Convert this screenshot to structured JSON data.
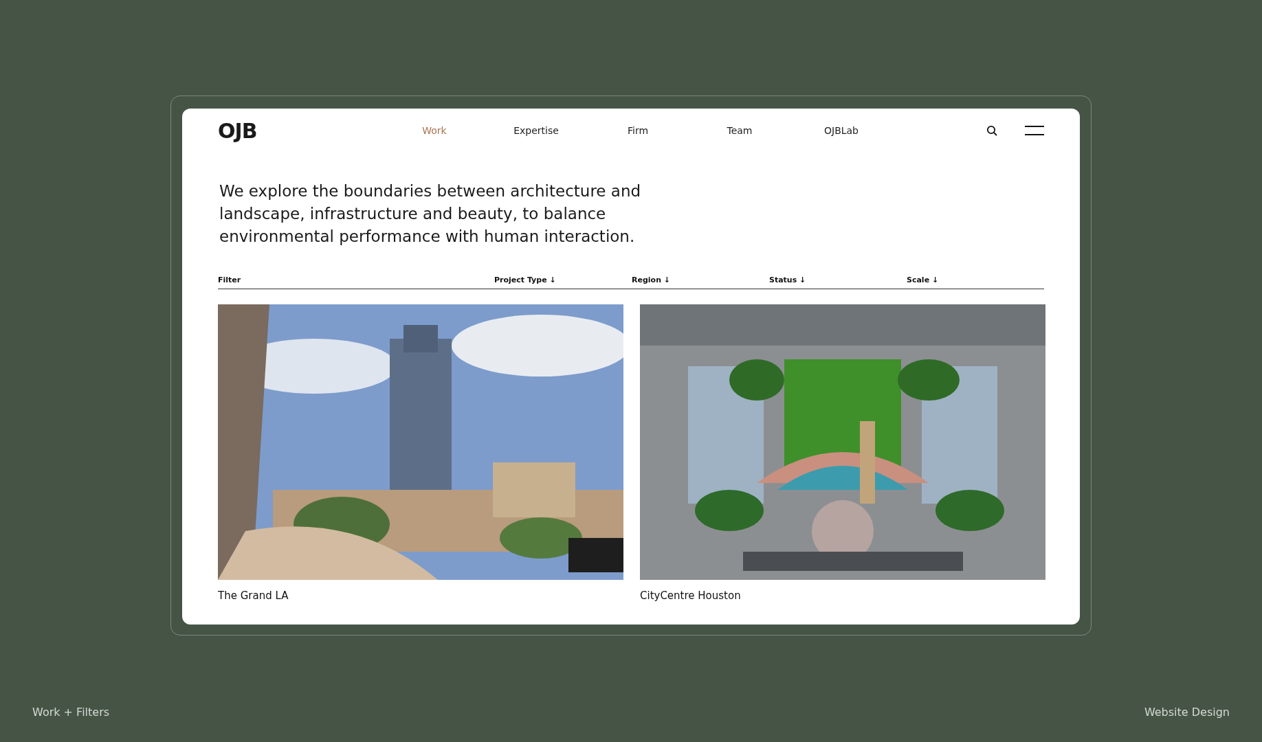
{
  "logo": "OJB",
  "nav": [
    {
      "label": "Work",
      "selected": true
    },
    {
      "label": "Expertise",
      "selected": false
    },
    {
      "label": "Firm",
      "selected": false
    },
    {
      "label": "Team",
      "selected": false
    },
    {
      "label": "OJBLab",
      "selected": false
    }
  ],
  "intro": "We explore the boundaries between architecture and landscape, infrastructure and beauty, to balance environmental performance with human interaction.",
  "filter_bar": {
    "label": "Filter",
    "filters": [
      "Project Type ↓",
      "Region ↓",
      "Status ↓",
      "Scale ↓"
    ]
  },
  "projects": [
    {
      "title": "The Grand LA",
      "kind": "street"
    },
    {
      "title": "CityCentre Houston",
      "kind": "aerial"
    }
  ],
  "captions": {
    "left": "Work + Filters",
    "right": "Website Design"
  }
}
